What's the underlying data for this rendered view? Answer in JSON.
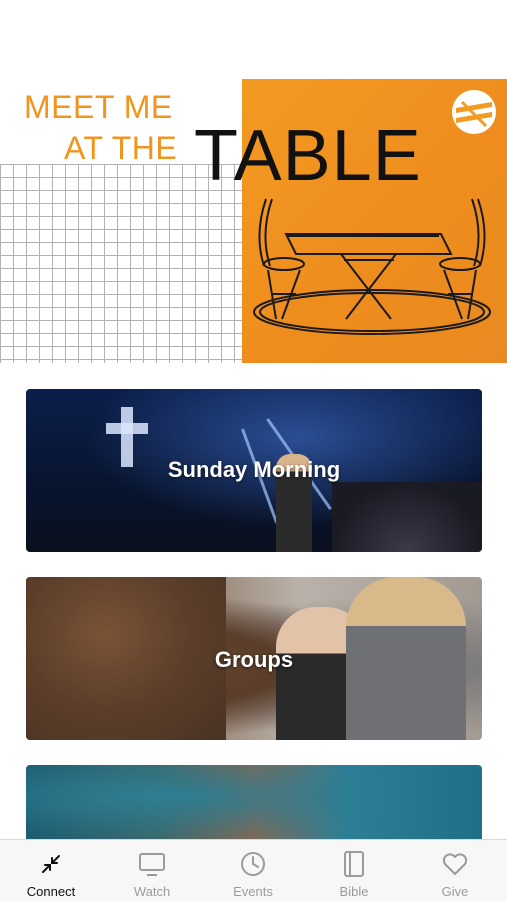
{
  "status_bar": {
    "text": ""
  },
  "hero": {
    "line1": "MEET ME",
    "line2": "AT THE",
    "line3": "TABLE",
    "logo_icon": "church-logo-icon",
    "colors": {
      "orange": "#f39a22",
      "accent_text": "#f0951f"
    }
  },
  "cards": [
    {
      "title": "Sunday Morning"
    },
    {
      "title": "Groups"
    },
    {
      "title": ""
    }
  ],
  "tabbar": {
    "active": "Connect",
    "tabs": [
      {
        "label": "Connect",
        "icon": "collapse-arrows-icon"
      },
      {
        "label": "Watch",
        "icon": "tv-icon"
      },
      {
        "label": "Events",
        "icon": "clock-icon"
      },
      {
        "label": "Bible",
        "icon": "book-icon"
      },
      {
        "label": "Give",
        "icon": "heart-icon"
      }
    ]
  }
}
